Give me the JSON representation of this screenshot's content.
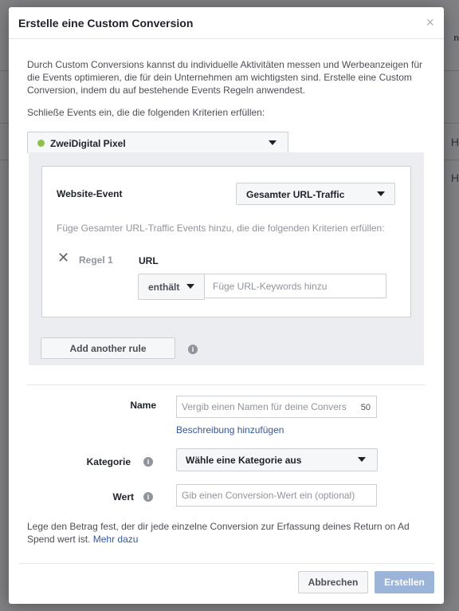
{
  "modal": {
    "title": "Erstelle eine Custom Conversion",
    "close_glyph": "×",
    "intro": "Durch Custom Conversions kannst du individuelle Aktivitäten messen und Werbeanzeigen für die Events optimieren, die für dein Unternehmen am wichtigsten sind. Erstelle eine Custom Conversion, indem du auf bestehende Events Regeln anwendest.",
    "criteria_label": "Schließe Events ein, die die folgenden Kriterien erfüllen:"
  },
  "pixel": {
    "name": "ZweiDigital Pixel",
    "status_color": "#8bc34a"
  },
  "rule_panel": {
    "website_event_label": "Website-Event",
    "event_selected": "Gesamter URL-Traffic",
    "hint": "Füge Gesamter URL-Traffic Events hinzu, die die folgenden Kriterien erfüllen:",
    "rules": [
      {
        "label": "Regel 1",
        "field": "URL",
        "operator": "enthält",
        "keyword_placeholder": "Füge URL-Keywords hinzu"
      }
    ],
    "add_rule_label": "Add another rule"
  },
  "form": {
    "name_label": "Name",
    "name_placeholder": "Vergib einen Namen für deine Convers",
    "name_char_count": "50",
    "description_link": "Beschreibung hinzufügen",
    "category_label": "Kategorie",
    "category_selected": "Wähle eine Kategorie aus",
    "value_label": "Wert",
    "value_placeholder": "Gib einen Conversion-Wert ein (optional)",
    "footer_note": "Lege den Betrag fest, der dir jede einzelne Conversion zur Erfassung deines Return on Ad Spend wert ist.",
    "footer_link": "Mehr dazu"
  },
  "buttons": {
    "cancel": "Abbrechen",
    "create": "Erstellen"
  },
  "background": {
    "right_labels": [
      "n",
      "H",
      "H"
    ]
  },
  "colors": {
    "link": "#365899",
    "create_button_disabled": "#9cb4d8"
  }
}
